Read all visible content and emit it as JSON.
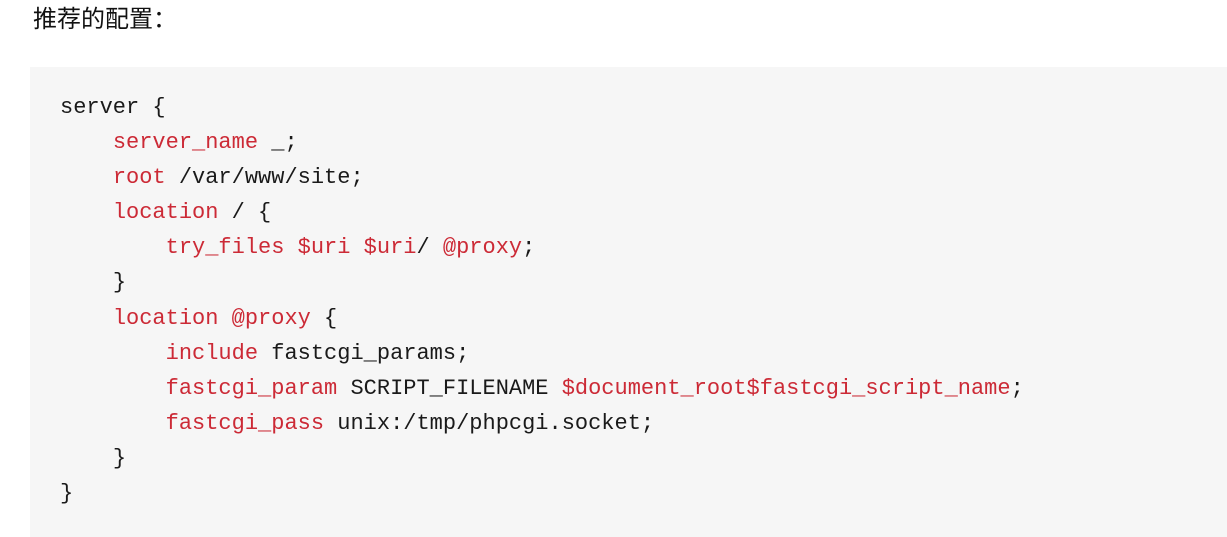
{
  "heading": "推荐的配置：",
  "code": {
    "language": "nginx",
    "lines": [
      {
        "indent": "",
        "tokens": [
          {
            "t": "server {",
            "k": "txt"
          }
        ]
      },
      {
        "indent": "    ",
        "tokens": [
          {
            "t": "server_name",
            "k": "kw"
          },
          {
            "t": " _;",
            "k": "txt"
          }
        ]
      },
      {
        "indent": "    ",
        "tokens": [
          {
            "t": "root",
            "k": "kw"
          },
          {
            "t": " /var/www/site;",
            "k": "txt"
          }
        ]
      },
      {
        "indent": "    ",
        "tokens": [
          {
            "t": "location",
            "k": "kw"
          },
          {
            "t": " / {",
            "k": "txt"
          }
        ]
      },
      {
        "indent": "        ",
        "tokens": [
          {
            "t": "try_files",
            "k": "kw"
          },
          {
            "t": " ",
            "k": "txt"
          },
          {
            "t": "$uri",
            "k": "kw"
          },
          {
            "t": " ",
            "k": "txt"
          },
          {
            "t": "$uri",
            "k": "kw"
          },
          {
            "t": "/ ",
            "k": "txt"
          },
          {
            "t": "@proxy",
            "k": "kw"
          },
          {
            "t": ";",
            "k": "txt"
          }
        ]
      },
      {
        "indent": "    ",
        "tokens": [
          {
            "t": "}",
            "k": "txt"
          }
        ]
      },
      {
        "indent": "    ",
        "tokens": [
          {
            "t": "location",
            "k": "kw"
          },
          {
            "t": " ",
            "k": "txt"
          },
          {
            "t": "@proxy",
            "k": "kw"
          },
          {
            "t": " {",
            "k": "txt"
          }
        ]
      },
      {
        "indent": "        ",
        "tokens": [
          {
            "t": "include",
            "k": "kw"
          },
          {
            "t": " fastcgi_params;",
            "k": "txt"
          }
        ]
      },
      {
        "indent": "        ",
        "tokens": [
          {
            "t": "fastcgi_param",
            "k": "kw"
          },
          {
            "t": " SCRIPT_FILENAME ",
            "k": "txt"
          },
          {
            "t": "$document_root$fastcgi_script_name",
            "k": "kw"
          },
          {
            "t": ";",
            "k": "txt"
          }
        ]
      },
      {
        "indent": "        ",
        "tokens": [
          {
            "t": "fastcgi_pass",
            "k": "kw"
          },
          {
            "t": " unix:/tmp/phpcgi.socket;",
            "k": "txt"
          }
        ]
      },
      {
        "indent": "    ",
        "tokens": [
          {
            "t": "}",
            "k": "txt"
          }
        ]
      },
      {
        "indent": "",
        "tokens": [
          {
            "t": "}",
            "k": "txt"
          }
        ]
      }
    ]
  },
  "colors": {
    "keyword": "#cc2a36",
    "text": "#1a1a1a",
    "code_background": "#f6f6f6"
  }
}
